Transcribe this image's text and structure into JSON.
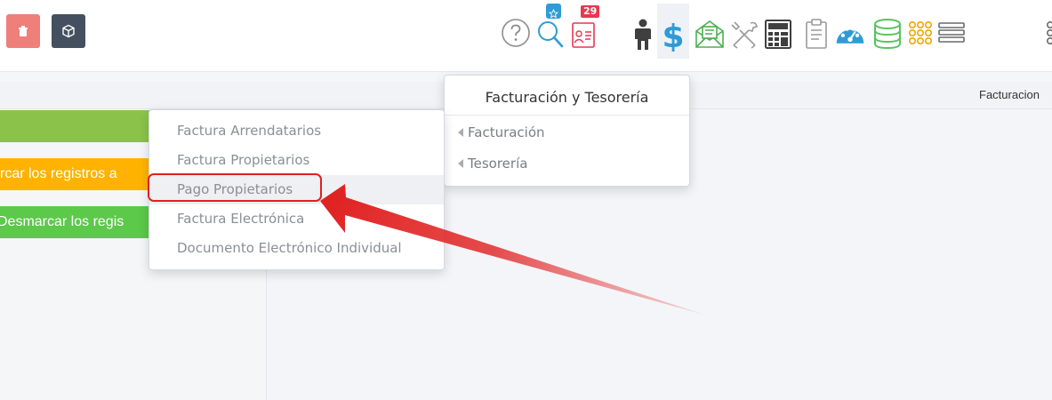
{
  "toolbar": {
    "left_buttons": [
      {
        "name": "trash-icon"
      },
      {
        "name": "cube-icon"
      }
    ],
    "icons": [
      {
        "name": "help-icon"
      },
      {
        "name": "favorites-search-icon"
      },
      {
        "name": "calendar-contact-icon",
        "badge": "29"
      },
      {
        "name": "person-icon"
      },
      {
        "name": "dollar-icon",
        "active": true
      },
      {
        "name": "mail-open-icon"
      },
      {
        "name": "tools-icon"
      },
      {
        "name": "calculator-icon"
      },
      {
        "name": "clipboard-icon"
      },
      {
        "name": "dashboard-icon"
      },
      {
        "name": "database-icon"
      },
      {
        "name": "grid-dots-icon"
      },
      {
        "name": "list-icon"
      }
    ]
  },
  "strip": {
    "right_text": "Facturacion"
  },
  "left_bars": {
    "orange_text": "rcar los registros a",
    "lime_text": "Desmarcar los regis"
  },
  "menu_right": {
    "title": "Facturación y Tesorería",
    "items": [
      "Facturación",
      "Tesorería"
    ]
  },
  "menu_left": {
    "items": [
      "Factura Arrendatarios",
      "Factura Propietarios",
      "Pago Propietarios",
      "Factura Electrónica",
      "Documento Electrónico Individual"
    ],
    "highlighted": "Pago Propietarios"
  },
  "colors": {
    "trash": "#ee7f7a",
    "cube": "#44505f",
    "green_bar": "#8bc34a",
    "orange_bar": "#ffb300",
    "lime_bar": "#5cc94a",
    "annotation": "#e02020"
  }
}
